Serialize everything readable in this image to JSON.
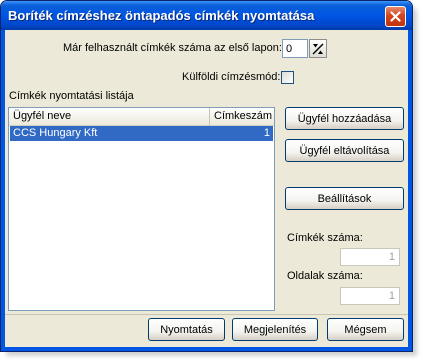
{
  "window": {
    "title": "Boríték címzéshez öntapadós címkék nyomtatása"
  },
  "fields": {
    "used_labels_label": "Már felhasznált címkék száma az első lapon:",
    "used_labels_value": "0",
    "foreign_address_label": "Külföldi címzésmód:",
    "foreign_address_checked": false
  },
  "list": {
    "title": "Címkék nyomtatási listája",
    "columns": [
      "Ügyfél neve",
      "Címkeszám"
    ],
    "rows": [
      {
        "name": "CCS Hungary Kft",
        "count": "1",
        "selected": true
      }
    ]
  },
  "side_buttons": {
    "add_client": "Ügyfél hozzáadása",
    "remove_client": "Ügyfél eltávolítása",
    "settings": "Beállítások"
  },
  "stats": {
    "labels_count_label": "Címkék száma:",
    "labels_count_value": "1",
    "pages_count_label": "Oldalak száma:",
    "pages_count_value": "1"
  },
  "footer": {
    "print": "Nyomtatás",
    "preview": "Megjelenítés",
    "cancel": "Mégsem"
  },
  "colors": {
    "title_bar": "#0055e5",
    "selection": "#316ac5",
    "close_button": "#d3451f"
  }
}
